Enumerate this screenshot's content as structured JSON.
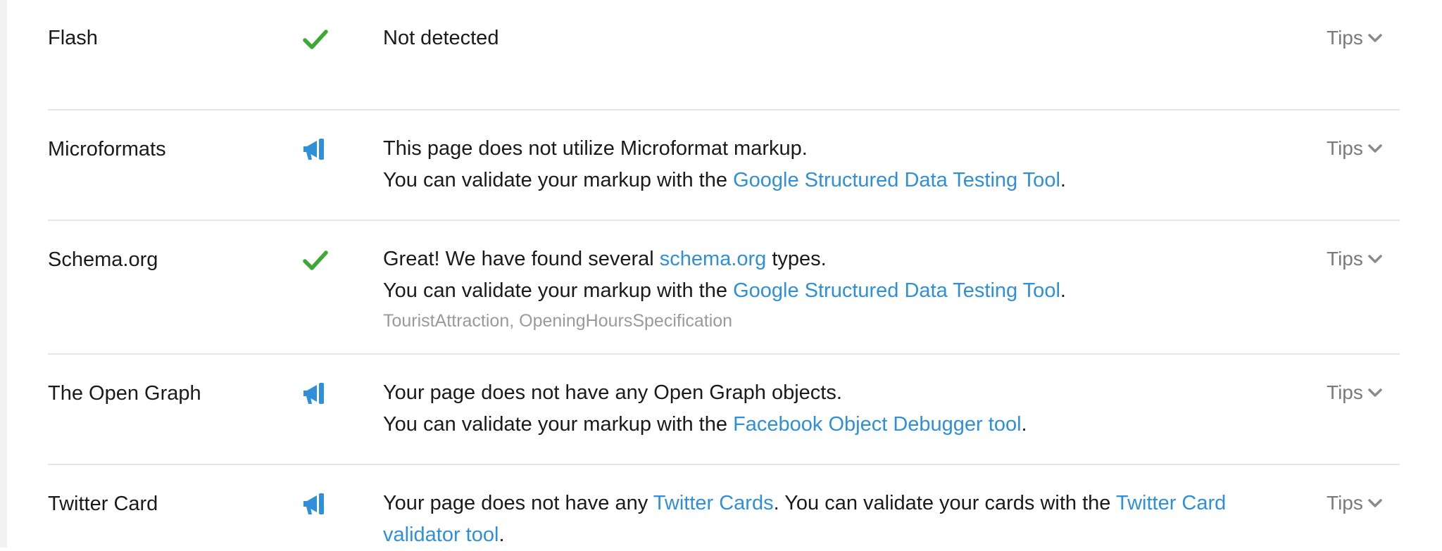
{
  "colors": {
    "check": "#3aaa35",
    "megaphone": "#2f8fd8",
    "link": "#2f8fd8",
    "muted": "#9a9a9a",
    "divider": "#e6e6e6"
  },
  "rows": [
    {
      "label": "Flash",
      "status_icon": "check-icon",
      "line1": "Not detected",
      "tips": "Tips"
    },
    {
      "label": "Microformats",
      "status_icon": "megaphone-icon",
      "line1": "This page does not utilize Microformat markup.",
      "line2_pre": "You can validate your markup with the ",
      "line2_link": "Google Structured Data Testing Tool",
      "line2_post": ".",
      "tips": "Tips"
    },
    {
      "label": "Schema.org",
      "status_icon": "check-icon",
      "line1_pre": "Great! We have found several ",
      "line1_link": "schema.org",
      "line1_post": " types.",
      "line2_pre": "You can validate your markup with the ",
      "line2_link": "Google Structured Data Testing Tool",
      "line2_post": ".",
      "types": "TouristAttraction, OpeningHoursSpecification",
      "tips": "Tips"
    },
    {
      "label": "The Open Graph",
      "status_icon": "megaphone-icon",
      "line1": "Your page does not have any Open Graph objects.",
      "line2_pre": "You can validate your markup with the ",
      "line2_link": "Facebook Object Debugger tool",
      "line2_post": ".",
      "tips": "Tips"
    },
    {
      "label": "Twitter Card",
      "status_icon": "megaphone-icon",
      "line1_pre": "Your page does not have any ",
      "line1_link": "Twitter Cards",
      "line1_mid": ". You can validate your cards with the ",
      "line1_link2": "Twitter Card validator tool",
      "line1_post": ".",
      "tips": "Tips"
    }
  ]
}
